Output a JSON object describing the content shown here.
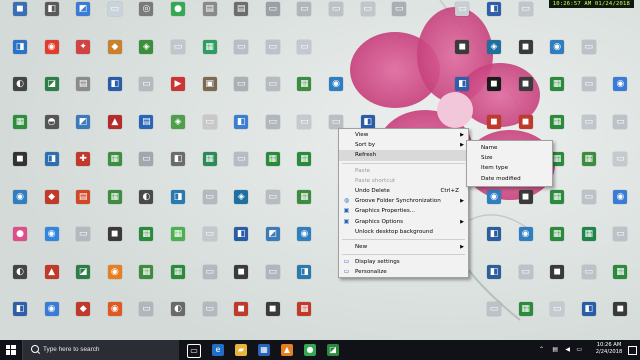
{
  "clock_overlay": "10:26:57 AM 01/24/2018",
  "desktop_icons": [
    {
      "col": 0,
      "row": 0,
      "label": "",
      "color": "#3b6fb5",
      "glyph": "◼"
    },
    {
      "col": 1,
      "row": 0,
      "label": "",
      "color": "#5a5a5a",
      "glyph": "◧"
    },
    {
      "col": 2,
      "row": 0,
      "label": "",
      "color": "#3a7bd5",
      "glyph": "◩"
    },
    {
      "col": 3,
      "row": 0,
      "label": "",
      "color": "#c8d3dc",
      "glyph": "▭"
    },
    {
      "col": 4,
      "row": 0,
      "label": "",
      "color": "#7a7a7a",
      "glyph": "◎"
    },
    {
      "col": 5,
      "row": 0,
      "label": "",
      "color": "#34a853",
      "glyph": "●"
    },
    {
      "col": 6,
      "row": 0,
      "label": "",
      "color": "#8a8a8a",
      "glyph": "▤"
    },
    {
      "col": 7,
      "row": 0,
      "label": "",
      "color": "#6d6d6d",
      "glyph": "▤"
    },
    {
      "col": 0,
      "row": 1,
      "label": "",
      "color": "#2b73c9",
      "glyph": "◨"
    },
    {
      "col": 1,
      "row": 1,
      "label": "",
      "color": "#e23c2c",
      "glyph": "◉"
    },
    {
      "col": 2,
      "row": 1,
      "label": "",
      "color": "#d14343",
      "glyph": "✦"
    },
    {
      "col": 3,
      "row": 1,
      "label": "",
      "color": "#c9812e",
      "glyph": "◆"
    },
    {
      "col": 4,
      "row": 1,
      "label": "",
      "color": "#3a8f3a",
      "glyph": "◈"
    },
    {
      "col": 5,
      "row": 1,
      "label": "",
      "color": "#c0c6cc",
      "glyph": "▭"
    },
    {
      "col": 6,
      "row": 1,
      "label": "",
      "color": "#2f9d5f",
      "glyph": "▦"
    },
    {
      "col": 7,
      "row": 1,
      "label": "",
      "color": "#b7bec4",
      "glyph": "▭"
    },
    {
      "col": 0,
      "row": 2,
      "label": "",
      "color": "#444",
      "glyph": "◐"
    },
    {
      "col": 1,
      "row": 2,
      "label": "",
      "color": "#2d7d46",
      "glyph": "◪"
    },
    {
      "col": 2,
      "row": 2,
      "label": "",
      "color": "#8b8b8b",
      "glyph": "▤"
    },
    {
      "col": 3,
      "row": 2,
      "label": "",
      "color": "#2a5ca8",
      "glyph": "◧"
    },
    {
      "col": 4,
      "row": 2,
      "label": "",
      "color": "#b3bbc1",
      "glyph": "▭"
    },
    {
      "col": 5,
      "row": 2,
      "label": "",
      "color": "#c33",
      "glyph": "▶"
    },
    {
      "col": 6,
      "row": 2,
      "label": "",
      "color": "#7b6a52",
      "glyph": "▣"
    },
    {
      "col": 7,
      "row": 2,
      "label": "",
      "color": "#a9b0b6",
      "glyph": "▭"
    },
    {
      "col": 0,
      "row": 3,
      "label": "",
      "color": "#2c8f3c",
      "glyph": "▦"
    },
    {
      "col": 1,
      "row": 3,
      "label": "",
      "color": "#555",
      "glyph": "◓"
    },
    {
      "col": 2,
      "row": 3,
      "label": "",
      "color": "#3c7bb9",
      "glyph": "◩"
    },
    {
      "col": 3,
      "row": 3,
      "label": "",
      "color": "#b62b2b",
      "glyph": "▲"
    },
    {
      "col": 4,
      "row": 3,
      "label": "",
      "color": "#2a64b8",
      "glyph": "▤"
    },
    {
      "col": 5,
      "row": 3,
      "label": "",
      "color": "#4e9e4e",
      "glyph": "◈"
    },
    {
      "col": 6,
      "row": 3,
      "label": "",
      "color": "#c8c8c8",
      "glyph": "▭"
    },
    {
      "col": 7,
      "row": 3,
      "label": "",
      "color": "#3b7fd1",
      "glyph": "◧"
    },
    {
      "col": 0,
      "row": 4,
      "label": "",
      "color": "#333",
      "glyph": "◼"
    },
    {
      "col": 1,
      "row": 4,
      "label": "",
      "color": "#2d6fb0",
      "glyph": "◨"
    },
    {
      "col": 2,
      "row": 4,
      "label": "",
      "color": "#c0392b",
      "glyph": "✚"
    },
    {
      "col": 3,
      "row": 4,
      "label": "",
      "color": "#3e8e41",
      "glyph": "▦"
    },
    {
      "col": 4,
      "row": 4,
      "label": "",
      "color": "#a0a7ad",
      "glyph": "▭"
    },
    {
      "col": 5,
      "row": 4,
      "label": "",
      "color": "#6b6b6b",
      "glyph": "◧"
    },
    {
      "col": 6,
      "row": 4,
      "label": "",
      "color": "#2e8b57",
      "glyph": "▦"
    },
    {
      "col": 7,
      "row": 4,
      "label": "",
      "color": "#b5bcc2",
      "glyph": "▭"
    },
    {
      "col": 0,
      "row": 5,
      "label": "",
      "color": "#2f7ec1",
      "glyph": "◉"
    },
    {
      "col": 1,
      "row": 5,
      "label": "",
      "color": "#c0392b",
      "glyph": "◆"
    },
    {
      "col": 2,
      "row": 5,
      "label": "",
      "color": "#d24726",
      "glyph": "▤"
    },
    {
      "col": 3,
      "row": 5,
      "label": "",
      "color": "#3d8c40",
      "glyph": "▦"
    },
    {
      "col": 4,
      "row": 5,
      "label": "",
      "color": "#4a4a4a",
      "glyph": "◐"
    },
    {
      "col": 5,
      "row": 5,
      "label": "",
      "color": "#2a7ab0",
      "glyph": "◨"
    },
    {
      "col": 6,
      "row": 5,
      "label": "",
      "color": "#b3b9be",
      "glyph": "▭"
    },
    {
      "col": 7,
      "row": 5,
      "label": "",
      "color": "#1f6f9f",
      "glyph": "◈"
    },
    {
      "col": 0,
      "row": 6,
      "label": "",
      "color": "#e04e8a",
      "glyph": "●"
    },
    {
      "col": 1,
      "row": 6,
      "label": "",
      "color": "#2e86de",
      "glyph": "◉"
    },
    {
      "col": 2,
      "row": 6,
      "label": "",
      "color": "#b3b9be",
      "glyph": "▭"
    },
    {
      "col": 3,
      "row": 6,
      "label": "",
      "color": "#3a3a3a",
      "glyph": "◼"
    },
    {
      "col": 4,
      "row": 6,
      "label": "",
      "color": "#2c8a3d",
      "glyph": "▦"
    },
    {
      "col": 5,
      "row": 6,
      "label": "",
      "color": "#4caf50",
      "glyph": "▦"
    },
    {
      "col": 6,
      "row": 6,
      "label": "",
      "color": "#c4c9cd",
      "glyph": "▭"
    },
    {
      "col": 7,
      "row": 6,
      "label": "",
      "color": "#2a5ca8",
      "glyph": "◧"
    },
    {
      "col": 0,
      "row": 7,
      "label": "",
      "color": "#444",
      "glyph": "◐"
    },
    {
      "col": 1,
      "row": 7,
      "label": "",
      "color": "#c0392b",
      "glyph": "▲"
    },
    {
      "col": 2,
      "row": 7,
      "label": "",
      "color": "#2d7d46",
      "glyph": "◪"
    },
    {
      "col": 3,
      "row": 7,
      "label": "",
      "color": "#e67e22",
      "glyph": "◉"
    },
    {
      "col": 4,
      "row": 7,
      "label": "",
      "color": "#3d8c40",
      "glyph": "▦"
    },
    {
      "col": 5,
      "row": 7,
      "label": "",
      "color": "#2c8a3d",
      "glyph": "▦"
    },
    {
      "col": 6,
      "row": 7,
      "label": "",
      "color": "#b3b9be",
      "glyph": "▭"
    },
    {
      "col": 7,
      "row": 7,
      "label": "",
      "color": "#3b3b3b",
      "glyph": "◼"
    },
    {
      "col": 0,
      "row": 8,
      "label": "",
      "color": "#2f5fa8",
      "glyph": "◧"
    },
    {
      "col": 1,
      "row": 8,
      "label": "",
      "color": "#3a7bd5",
      "glyph": "◉"
    },
    {
      "col": 2,
      "row": 8,
      "label": "",
      "color": "#c0392b",
      "glyph": "◆"
    },
    {
      "col": 3,
      "row": 8,
      "label": "",
      "color": "#e25822",
      "glyph": "◉"
    },
    {
      "col": 4,
      "row": 8,
      "label": "",
      "color": "#b0b6bb",
      "glyph": "▭"
    },
    {
      "col": 5,
      "row": 8,
      "label": "",
      "color": "#6a6a6a",
      "glyph": "◐"
    },
    {
      "col": 6,
      "row": 8,
      "label": "",
      "color": "#b3b9be",
      "glyph": "▭"
    },
    {
      "col": 7,
      "row": 8,
      "label": "",
      "color": "#c0392b",
      "glyph": "◼"
    },
    {
      "col": 8,
      "row": 0,
      "label": "",
      "color": "#9aa0a5",
      "glyph": "▭"
    },
    {
      "col": 9,
      "row": 0,
      "label": "",
      "color": "#b0b6bb",
      "glyph": "▭"
    },
    {
      "col": 10,
      "row": 0,
      "label": "",
      "color": "#bcc2c7",
      "glyph": "▭"
    },
    {
      "col": 11,
      "row": 0,
      "label": "",
      "color": "#c0c6cb",
      "glyph": "▭"
    },
    {
      "col": 12,
      "row": 0,
      "label": "",
      "color": "#a9afb4",
      "glyph": "▭"
    },
    {
      "col": 8,
      "row": 1,
      "label": "",
      "color": "#bcc2c7",
      "glyph": "▭"
    },
    {
      "col": 9,
      "row": 1,
      "label": "",
      "color": "#c3c9ce",
      "glyph": "▭"
    },
    {
      "col": 8,
      "row": 2,
      "label": "",
      "color": "#b5bbc0",
      "glyph": "▭"
    },
    {
      "col": 9,
      "row": 2,
      "label": "",
      "color": "#3d8c40",
      "glyph": "▦"
    },
    {
      "col": 10,
      "row": 2,
      "label": "",
      "color": "#2f7ec1",
      "glyph": "◉"
    },
    {
      "col": 8,
      "row": 3,
      "label": "",
      "color": "#b1b7bc",
      "glyph": "▭"
    },
    {
      "col": 9,
      "row": 3,
      "label": "",
      "color": "#c4cacf",
      "glyph": "▭"
    },
    {
      "col": 10,
      "row": 3,
      "label": "",
      "color": "#b9bfc4",
      "glyph": "▭"
    },
    {
      "col": 11,
      "row": 3,
      "label": "",
      "color": "#2a5ca8",
      "glyph": "◧"
    },
    {
      "col": 8,
      "row": 4,
      "label": "",
      "color": "#2c8a3d",
      "glyph": "▦"
    },
    {
      "col": 9,
      "row": 4,
      "label": "",
      "color": "#2c8a3d",
      "glyph": "▦"
    },
    {
      "col": 8,
      "row": 5,
      "label": "",
      "color": "#b6bcc1",
      "glyph": "▭"
    },
    {
      "col": 9,
      "row": 5,
      "label": "",
      "color": "#3d8c40",
      "glyph": "▦"
    },
    {
      "col": 8,
      "row": 6,
      "label": "",
      "color": "#3c7bb9",
      "glyph": "◩"
    },
    {
      "col": 9,
      "row": 6,
      "label": "",
      "color": "#2f7ec1",
      "glyph": "◉"
    },
    {
      "col": 8,
      "row": 7,
      "label": "",
      "color": "#b0b6bb",
      "glyph": "▭"
    },
    {
      "col": 9,
      "row": 7,
      "label": "",
      "color": "#2a7ab0",
      "glyph": "◨"
    },
    {
      "col": 8,
      "row": 8,
      "label": "",
      "color": "#3a3a3a",
      "glyph": "◼"
    },
    {
      "col": 9,
      "row": 8,
      "label": "",
      "color": "#c0392b",
      "glyph": "▦"
    },
    {
      "col": 14,
      "row": 0,
      "label": "",
      "color": "#c8ced3",
      "glyph": "▭"
    },
    {
      "col": 15,
      "row": 0,
      "label": "",
      "color": "#2f5fa8",
      "glyph": "◧"
    },
    {
      "col": 16,
      "row": 0,
      "label": "",
      "color": "#c0c6cb",
      "glyph": "▭"
    },
    {
      "col": 14,
      "row": 1,
      "label": "",
      "color": "#3a3a3a",
      "glyph": "◼"
    },
    {
      "col": 15,
      "row": 1,
      "label": "",
      "color": "#1f6f9f",
      "glyph": "◈"
    },
    {
      "col": 16,
      "row": 1,
      "label": "",
      "color": "#3a3a3a",
      "glyph": "◼"
    },
    {
      "col": 17,
      "row": 1,
      "label": "",
      "color": "#2f7ec1",
      "glyph": "◉"
    },
    {
      "col": 18,
      "row": 1,
      "label": "",
      "color": "#bcc2c7",
      "glyph": "▭"
    },
    {
      "col": 14,
      "row": 2,
      "label": "",
      "color": "#2f5fa8",
      "glyph": "◧"
    },
    {
      "col": 15,
      "row": 2,
      "label": "",
      "color": "#1a1a1a",
      "glyph": "◼"
    },
    {
      "col": 16,
      "row": 2,
      "label": "",
      "color": "#3b3b3b",
      "glyph": "◼"
    },
    {
      "col": 17,
      "row": 2,
      "label": "",
      "color": "#2c8a3d",
      "glyph": "▦"
    },
    {
      "col": 18,
      "row": 2,
      "label": "",
      "color": "#bcc2c7",
      "glyph": "▭"
    },
    {
      "col": 19,
      "row": 2,
      "label": "",
      "color": "#3a7bd5",
      "glyph": "◉"
    },
    {
      "col": 15,
      "row": 3,
      "label": "",
      "color": "#c0392b",
      "glyph": "◼"
    },
    {
      "col": 16,
      "row": 3,
      "label": "",
      "color": "#c0392b",
      "glyph": "◼"
    },
    {
      "col": 17,
      "row": 3,
      "label": "",
      "color": "#2c8a3d",
      "glyph": "▦"
    },
    {
      "col": 18,
      "row": 3,
      "label": "",
      "color": "#c0c6cb",
      "glyph": "▭"
    },
    {
      "col": 19,
      "row": 3,
      "label": "",
      "color": "#bcc2c7",
      "glyph": "▭"
    },
    {
      "col": 17,
      "row": 4,
      "label": "",
      "color": "#2c8a3d",
      "glyph": "▦"
    },
    {
      "col": 18,
      "row": 4,
      "label": "",
      "color": "#3d8c40",
      "glyph": "▦"
    },
    {
      "col": 19,
      "row": 4,
      "label": "",
      "color": "#c4cacf",
      "glyph": "▭"
    },
    {
      "col": 14,
      "row": 5,
      "label": "",
      "color": "#2c5e9e",
      "glyph": "◧"
    },
    {
      "col": 15,
      "row": 5,
      "label": "",
      "color": "#2f7ec1",
      "glyph": "◉"
    },
    {
      "col": 16,
      "row": 5,
      "label": "",
      "color": "#3a3a3a",
      "glyph": "◼"
    },
    {
      "col": 17,
      "row": 5,
      "label": "",
      "color": "#2c8a3d",
      "glyph": "▦"
    },
    {
      "col": 18,
      "row": 5,
      "label": "",
      "color": "#bcc2c7",
      "glyph": "▭"
    },
    {
      "col": 19,
      "row": 5,
      "label": "",
      "color": "#3a7bd5",
      "glyph": "◉"
    },
    {
      "col": 15,
      "row": 6,
      "label": "",
      "color": "#2c5e9e",
      "glyph": "◧"
    },
    {
      "col": 16,
      "row": 6,
      "label": "",
      "color": "#2f7ec1",
      "glyph": "◉"
    },
    {
      "col": 17,
      "row": 6,
      "label": "",
      "color": "#2c8a3d",
      "glyph": "▦"
    },
    {
      "col": 18,
      "row": 6,
      "label": "",
      "color": "#1e8449",
      "glyph": "▦"
    },
    {
      "col": 19,
      "row": 6,
      "label": "",
      "color": "#bcc2c7",
      "glyph": "▭"
    },
    {
      "col": 15,
      "row": 7,
      "label": "",
      "color": "#2c5e9e",
      "glyph": "◧"
    },
    {
      "col": 16,
      "row": 7,
      "label": "",
      "color": "#bcc2c7",
      "glyph": "▭"
    },
    {
      "col": 17,
      "row": 7,
      "label": "",
      "color": "#3a3a3a",
      "glyph": "◼"
    },
    {
      "col": 18,
      "row": 7,
      "label": "",
      "color": "#bcc2c7",
      "glyph": "▭"
    },
    {
      "col": 19,
      "row": 7,
      "label": "",
      "color": "#2c8a3d",
      "glyph": "▦"
    },
    {
      "col": 15,
      "row": 8,
      "label": "",
      "color": "#bcc2c7",
      "glyph": "▭"
    },
    {
      "col": 16,
      "row": 8,
      "label": "",
      "color": "#2c8a3d",
      "glyph": "▦"
    },
    {
      "col": 17,
      "row": 8,
      "label": "",
      "color": "#c4cacf",
      "glyph": "▭"
    },
    {
      "col": 18,
      "row": 8,
      "label": "",
      "color": "#2a5ca8",
      "glyph": "◧"
    },
    {
      "col": 19,
      "row": 8,
      "label": "",
      "color": "#3a3a3a",
      "glyph": "◼"
    }
  ],
  "context_menu": {
    "items": [
      {
        "type": "item",
        "label": "View",
        "submenu": true
      },
      {
        "type": "item",
        "label": "Sort by",
        "submenu": true
      },
      {
        "type": "item",
        "label": "Refresh",
        "highlight": true
      },
      {
        "type": "sep"
      },
      {
        "type": "item",
        "label": "Paste",
        "disabled": true
      },
      {
        "type": "item",
        "label": "Paste shortcut",
        "disabled": true
      },
      {
        "type": "item",
        "label": "Undo Delete",
        "shortcut": "Ctrl+Z"
      },
      {
        "type": "item",
        "label": "Groove Folder Synchronization",
        "submenu": true,
        "icon": "groove-icon",
        "glyph": "◍",
        "color": "#2f7ec1"
      },
      {
        "type": "item",
        "label": "Graphics Properties...",
        "icon": "graphics-properties-icon",
        "glyph": "▣",
        "color": "#2a64b8"
      },
      {
        "type": "item",
        "label": "Graphics Options",
        "submenu": true,
        "icon": "graphics-options-icon",
        "glyph": "▣",
        "color": "#2a64b8"
      },
      {
        "type": "item",
        "label": "Unlock desktop background"
      },
      {
        "type": "sep"
      },
      {
        "type": "item",
        "label": "New",
        "submenu": true
      },
      {
        "type": "sep"
      },
      {
        "type": "item",
        "label": "Display settings",
        "icon": "display-settings-icon",
        "glyph": "▭",
        "color": "#2a64b8"
      },
      {
        "type": "item",
        "label": "Personalize",
        "icon": "personalize-icon",
        "glyph": "▭",
        "color": "#2a64b8"
      }
    ]
  },
  "sort_submenu": {
    "items": [
      "Name",
      "Size",
      "Item type",
      "Date modified"
    ]
  },
  "taskbar": {
    "search_placeholder": "Type here to search",
    "time": "10:26 AM",
    "date": "2/24/2018",
    "icons": [
      {
        "name": "task-view-icon",
        "glyph": "▭",
        "color": "#101218"
      },
      {
        "name": "edge-icon",
        "glyph": "e",
        "color": "#1f6fc8"
      },
      {
        "name": "file-explorer-icon",
        "glyph": "▰",
        "color": "#e8b43a"
      },
      {
        "name": "store-icon",
        "glyph": "▦",
        "color": "#2a64b8"
      },
      {
        "name": "vlc-icon",
        "glyph": "▲",
        "color": "#e67e22"
      },
      {
        "name": "chrome-icon",
        "glyph": "●",
        "color": "#34a853"
      },
      {
        "name": "camtasia-icon",
        "glyph": "◪",
        "color": "#2c8a3d"
      }
    ]
  }
}
